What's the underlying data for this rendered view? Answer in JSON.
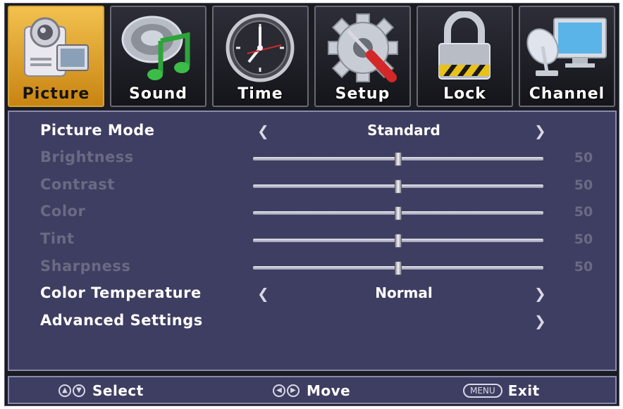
{
  "tabs": [
    {
      "label": "Picture",
      "icon": "camera-icon",
      "active": true
    },
    {
      "label": "Sound",
      "icon": "music-note-icon",
      "active": false
    },
    {
      "label": "Time",
      "icon": "clock-icon",
      "active": false
    },
    {
      "label": "Setup",
      "icon": "gear-screwdriver-icon",
      "active": false
    },
    {
      "label": "Lock",
      "icon": "padlock-icon",
      "active": false
    },
    {
      "label": "Channel",
      "icon": "satellite-monitor-icon",
      "active": false
    }
  ],
  "picture_mode": {
    "label": "Picture Mode",
    "value": "Standard"
  },
  "sliders": [
    {
      "label": "Brightness",
      "value": "50",
      "level": 50
    },
    {
      "label": "Contrast",
      "value": "50",
      "level": 50
    },
    {
      "label": "Color",
      "value": "50",
      "level": 50
    },
    {
      "label": "Tint",
      "value": "50",
      "level": 50
    },
    {
      "label": "Sharpness",
      "value": "50",
      "level": 50
    }
  ],
  "color_temperature": {
    "label": "Color Temperature",
    "value": "Normal"
  },
  "advanced_settings": {
    "label": "Advanced Settings"
  },
  "footer": {
    "select_label": "Select",
    "move_label": "Move",
    "menu_key": "MENU",
    "exit_label": "Exit"
  },
  "colors": {
    "panel": "#3e3e62",
    "active_tab": "#f2c14e",
    "dim_text": "#6a6a84"
  }
}
